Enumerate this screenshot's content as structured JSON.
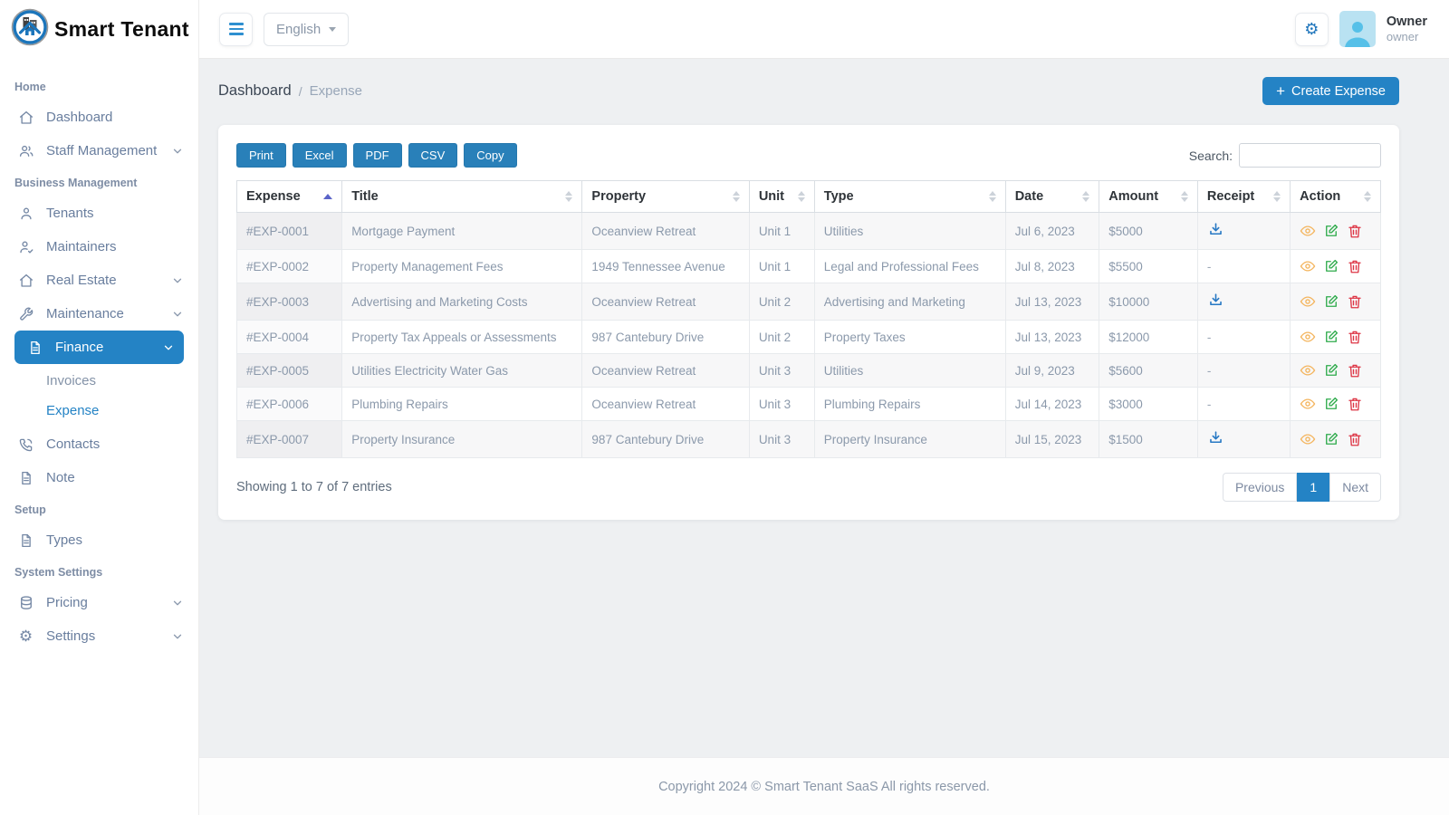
{
  "app": {
    "name": "Smart Tenant"
  },
  "topbar": {
    "language": "English",
    "user": {
      "name": "Owner",
      "role": "owner"
    }
  },
  "sidebar": {
    "sections": [
      {
        "header": "Home",
        "items": [
          {
            "label": "Dashboard"
          },
          {
            "label": "Staff Management"
          }
        ]
      },
      {
        "header": "Business Management",
        "items": [
          {
            "label": "Tenants"
          },
          {
            "label": "Maintainers"
          },
          {
            "label": "Real Estate"
          },
          {
            "label": "Maintenance"
          },
          {
            "label": "Finance",
            "children": [
              {
                "label": "Invoices"
              },
              {
                "label": "Expense"
              }
            ]
          },
          {
            "label": "Contacts"
          },
          {
            "label": "Note"
          }
        ]
      },
      {
        "header": "Setup",
        "items": [
          {
            "label": "Types"
          }
        ]
      },
      {
        "header": "System Settings",
        "items": [
          {
            "label": "Pricing"
          },
          {
            "label": "Settings"
          }
        ]
      }
    ]
  },
  "breadcrumb": {
    "root": "Dashboard",
    "separator": "/",
    "current": "Expense"
  },
  "create_button": {
    "icon": "+",
    "label": "Create Expense"
  },
  "toolbar": {
    "export_buttons": [
      "Print",
      "Excel",
      "PDF",
      "CSV",
      "Copy"
    ],
    "search_label": "Search:",
    "search_value": ""
  },
  "table": {
    "columns": [
      "Expense",
      "Title",
      "Property",
      "Unit",
      "Type",
      "Date",
      "Amount",
      "Receipt",
      "Action"
    ],
    "rows": [
      {
        "expense": "#EXP-0001",
        "title": "Mortgage Payment",
        "property": "Oceanview Retreat",
        "unit": "Unit 1",
        "type": "Utilities",
        "date": "Jul 6, 2023",
        "amount": "$5000",
        "receipt": "download"
      },
      {
        "expense": "#EXP-0002",
        "title": "Property Management Fees",
        "property": "1949 Tennessee Avenue",
        "unit": "Unit 1",
        "type": "Legal and Professional Fees",
        "date": "Jul 8, 2023",
        "amount": "$5500",
        "receipt": "-"
      },
      {
        "expense": "#EXP-0003",
        "title": "Advertising and Marketing Costs",
        "property": "Oceanview Retreat",
        "unit": "Unit 2",
        "type": "Advertising and Marketing",
        "date": "Jul 13, 2023",
        "amount": "$10000",
        "receipt": "download"
      },
      {
        "expense": "#EXP-0004",
        "title": "Property Tax Appeals or Assessments",
        "property": "987 Cantebury Drive",
        "unit": "Unit 2",
        "type": "Property Taxes",
        "date": "Jul 13, 2023",
        "amount": "$12000",
        "receipt": "-"
      },
      {
        "expense": "#EXP-0005",
        "title": "Utilities Electricity Water Gas",
        "property": "Oceanview Retreat",
        "unit": "Unit 3",
        "type": "Utilities",
        "date": "Jul 9, 2023",
        "amount": "$5600",
        "receipt": "-"
      },
      {
        "expense": "#EXP-0006",
        "title": "Plumbing Repairs",
        "property": "Oceanview Retreat",
        "unit": "Unit 3",
        "type": "Plumbing Repairs",
        "date": "Jul 14, 2023",
        "amount": "$3000",
        "receipt": "-"
      },
      {
        "expense": "#EXP-0007",
        "title": "Property Insurance",
        "property": "987 Cantebury Drive",
        "unit": "Unit 3",
        "type": "Property Insurance",
        "date": "Jul 15, 2023",
        "amount": "$1500",
        "receipt": "download"
      }
    ],
    "info": "Showing 1 to 7 of 7 entries",
    "sort": {
      "column": "Expense",
      "direction": "asc"
    }
  },
  "pagination": {
    "previous": "Previous",
    "current": "1",
    "next": "Next"
  },
  "footer": {
    "copyright": "Copyright 2024 © Smart Tenant SaaS All rights reserved."
  },
  "colors": {
    "primary": "#2483c5",
    "export_button": "#2980b9",
    "view_icon": "#f4b55e",
    "edit_icon": "#2eab4b",
    "delete_icon": "#dd3444",
    "download_icon": "#2778c4"
  }
}
